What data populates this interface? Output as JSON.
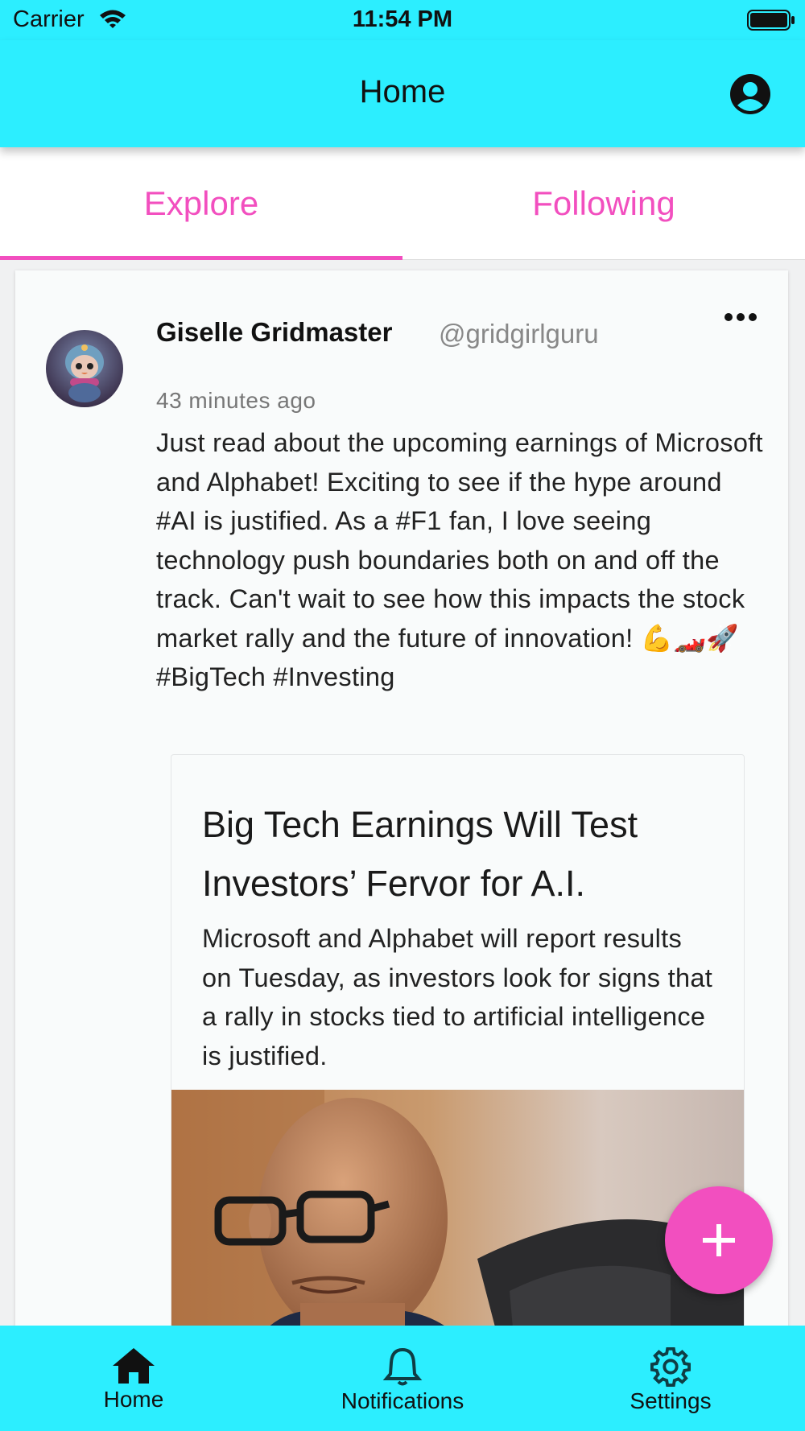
{
  "status_bar": {
    "carrier": "Carrier",
    "time": "11:54 PM"
  },
  "header": {
    "title": "Home",
    "profile_icon": "account-circle-icon"
  },
  "tabs": [
    {
      "label": "Explore",
      "selected": true
    },
    {
      "label": "Following",
      "selected": false
    }
  ],
  "post": {
    "author_name": "Giselle Gridmaster",
    "handle": "@gridgirlguru",
    "timestamp": "43 minutes ago",
    "text": "Just read about the upcoming earnings of Microsoft and Alphabet! Exciting to see if the hype around #AI is justified. As a #F1 fan, I love seeing technology push boundaries both on and off the track. Can't wait to see how this impacts the stock market rally and the future of innovation! 💪🏎️🚀 #BigTech #Investing",
    "link_preview": {
      "title": "Big Tech Earnings Will Test Investors’ Fervor for A.I.",
      "description": "Microsoft and Alphabet will report results on Tuesday, as investors look for signs that a rally in stocks tied to artificial intelligence is justified."
    }
  },
  "fab": {
    "icon": "plus-icon"
  },
  "bottom_nav": [
    {
      "label": "Home",
      "icon": "home-icon"
    },
    {
      "label": "Notifications",
      "icon": "bell-icon"
    },
    {
      "label": "Settings",
      "icon": "gear-icon"
    }
  ],
  "colors": {
    "primary": "#2ceeff",
    "accent": "#f24fbf",
    "card_background": "#f9fbfb",
    "page_background": "#f0f1f2"
  }
}
